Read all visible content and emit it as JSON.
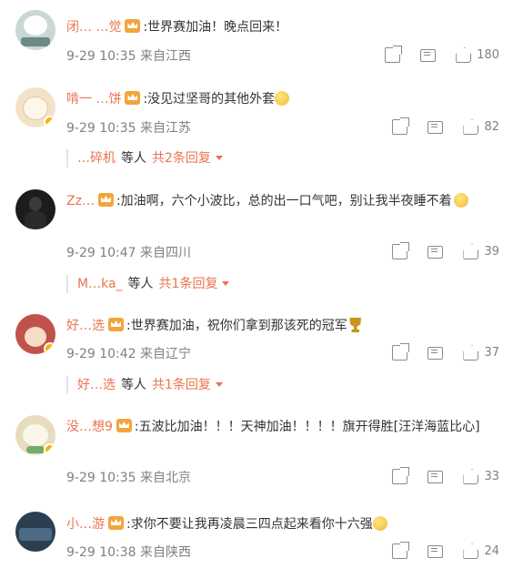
{
  "comments": [
    {
      "username": "闭… …觉",
      "text": "世界赛加油！晚点回来！",
      "date": "9-29 10:35",
      "location": "来自江西",
      "likes": "180",
      "avatar_color": "#c9d7d6"
    },
    {
      "username": "啃一 …饼",
      "text": "没见过坚哥的其他外套",
      "date": "9-29 10:35",
      "location": "来自江苏",
      "likes": "82",
      "avatar_color": "#f4e2c8",
      "replies": {
        "name": "…碎机",
        "etc": "等人",
        "more": "共2条回复"
      }
    },
    {
      "username": "Zz…",
      "text": "加油啊，六个小波比，总的出一口气吧，别让我半夜睡不着",
      "date": "9-29 10:47",
      "location": "来自四川",
      "likes": "39",
      "avatar_color": "#1c1c1c",
      "replies": {
        "name": "M…ka_",
        "etc": "等人",
        "more": "共1条回复"
      }
    },
    {
      "username": "好…选",
      "text": "世界赛加油，祝你们拿到那该死的冠军",
      "date": "9-29 10:42",
      "location": "来自辽宁",
      "likes": "37",
      "avatar_color": "#c0524c",
      "replies": {
        "name": "好…选",
        "etc": "等人",
        "more": "共1条回复"
      }
    },
    {
      "username": "没…想9",
      "text": "五波比加油！！！天神加油！！！！旗开得胜[汪洋海蓝比心]",
      "date": "9-29 10:35",
      "location": "来自北京",
      "likes": "33",
      "avatar_color": "#e7dcc0"
    },
    {
      "username": "小…游",
      "text": "求你不要让我再凌晨三四点起来看你十六强",
      "date": "9-29 10:38",
      "location": "来自陕西",
      "likes": "24",
      "avatar_color": "#2c3f52"
    }
  ]
}
